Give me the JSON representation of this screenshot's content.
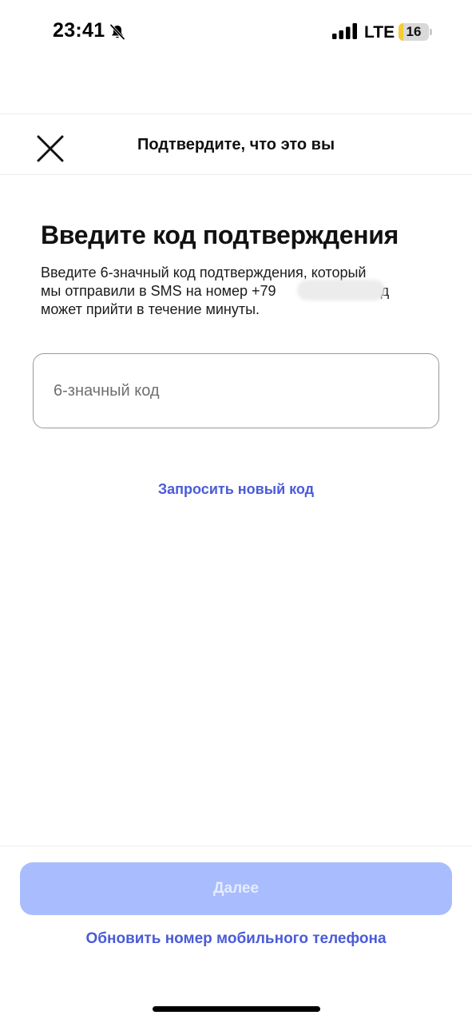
{
  "status_bar": {
    "time": "23:41",
    "network": "LTE",
    "battery": "16",
    "battery_percent": 16,
    "icons": [
      "bell-slash-icon",
      "signal-bars-icon"
    ]
  },
  "header": {
    "title": "Подтвердите, что это вы",
    "close_icon": "close-icon"
  },
  "main": {
    "title": "Введите код подтверждения",
    "description_line1": "Введите 6-значный код подтверждения, который",
    "description_line2": "мы отправили в SMS на номер +79",
    "description_line2_end": "Код",
    "description_line3": "может прийти в течение минуты.",
    "code_input": {
      "value": "",
      "placeholder": "6-значный код"
    },
    "request_new_code": "Запросить новый код"
  },
  "footer": {
    "next_label": "Далее",
    "update_phone_label": "Обновить номер мобильного телефона"
  },
  "colors": {
    "accent_link": "#4a5bd8",
    "button_disabled_bg": "#a9bcfd",
    "button_disabled_text": "#e6ecff",
    "battery_low": "#f4cc32"
  }
}
